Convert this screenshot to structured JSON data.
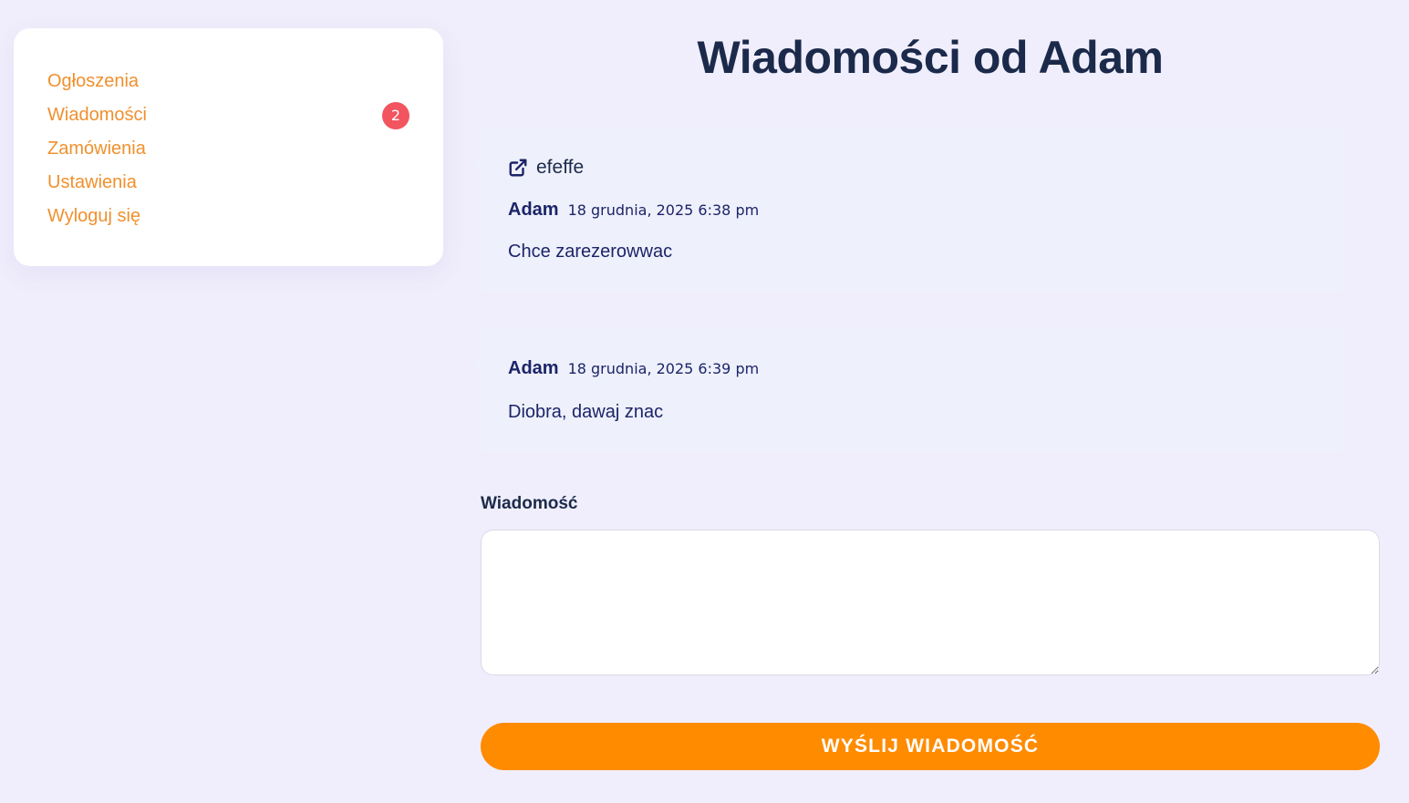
{
  "sidebar": {
    "items": [
      {
        "label": "Ogłoszenia"
      },
      {
        "label": "Wiadomości",
        "badge": "2"
      },
      {
        "label": "Zamówienia"
      },
      {
        "label": "Ustawienia"
      },
      {
        "label": "Wyloguj się"
      }
    ]
  },
  "main": {
    "title": "Wiadomości od Adam",
    "messages": [
      {
        "listing": "efeffe",
        "author": "Adam",
        "date": "18 grudnia, 2025 6:38 pm",
        "text": "Chce zarezerowwac"
      },
      {
        "author": "Adam",
        "date": "18 grudnia, 2025 6:39 pm",
        "text": "Diobra, dawaj znac"
      }
    ],
    "form": {
      "label": "Wiadomość",
      "value": "",
      "send_label": "WYŚLIJ WIADOMOŚĆ"
    }
  },
  "colors": {
    "accent": "#ff8b00",
    "nav_link": "#f0902e",
    "badge": "#f2555f",
    "background": "#f0eefc",
    "heading": "#1b2a4a"
  },
  "icons": {
    "listing_link": "external-link-icon"
  }
}
